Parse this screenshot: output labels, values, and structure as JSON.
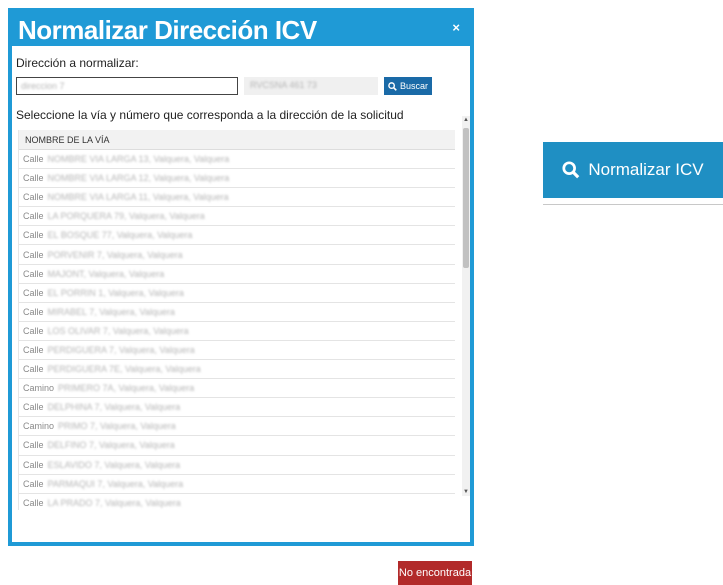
{
  "modal": {
    "title": "Normalizar Dirección ICV",
    "close_label": "×",
    "address_label": "Dirección a normalizar:",
    "address_value": "direccion 7",
    "code_value": "RVCSNA 461 73",
    "search_label": "Buscar",
    "instruction": "Seleccione la vía y número que corresponda a la dirección de la solicitud",
    "table": {
      "header": "NOMBRE DE LA VÍA",
      "rows": [
        {
          "type": "Calle",
          "detail": "NOMBRE VIA LARGA 13, Valquera, Valquera"
        },
        {
          "type": "Calle",
          "detail": "NOMBRE VIA LARGA 12, Valquera, Valquera"
        },
        {
          "type": "Calle",
          "detail": "NOMBRE VIA LARGA 11, Valquera, Valquera"
        },
        {
          "type": "Calle",
          "detail": "LA PORQUERA 79, Valquera, Valquera"
        },
        {
          "type": "Calle",
          "detail": "EL BOSQUE 77, Valquera, Valquera"
        },
        {
          "type": "Calle",
          "detail": "PORVENIR 7, Valquera, Valquera"
        },
        {
          "type": "Calle",
          "detail": "MAJONT, Valquera, Valquera"
        },
        {
          "type": "Calle",
          "detail": "EL PORRIN 1, Valquera, Valquera"
        },
        {
          "type": "Calle",
          "detail": "MIRABEL 7, Valquera, Valquera"
        },
        {
          "type": "Calle",
          "detail": "LOS OLIVAR 7, Valquera, Valquera"
        },
        {
          "type": "Calle",
          "detail": "PERDIGUERA 7, Valquera, Valquera"
        },
        {
          "type": "Calle",
          "detail": "PERDIGUERA 7E, Valquera, Valquera"
        },
        {
          "type": "Camino",
          "detail": "PRIMERO 7A, Valquera, Valquera"
        },
        {
          "type": "Calle",
          "detail": "DELPHINA 7, Valquera, Valquera"
        },
        {
          "type": "Camino",
          "detail": "PRIMO 7, Valquera, Valquera"
        },
        {
          "type": "Calle",
          "detail": "DELFINO 7, Valquera, Valquera"
        },
        {
          "type": "Calle",
          "detail": "ESLAVIDO 7, Valquera, Valquera"
        },
        {
          "type": "Calle",
          "detail": "PARMAQUI 7, Valquera, Valquera"
        },
        {
          "type": "Calle",
          "detail": "LA PRADO 7, Valquera, Valquera"
        }
      ]
    },
    "not_found_label": "No encontrada"
  },
  "normalize_button_label": "Normalizar ICV",
  "icons": {
    "search": "search-icon",
    "close": "close-icon",
    "scroll_up": "scroll-up-icon",
    "scroll_down": "scroll-down-icon"
  },
  "colors": {
    "modal_bg": "#1f9ad6",
    "search_button": "#1a6aa7",
    "not_found_button": "#b22a2a",
    "normalize_button": "#1f8fc3"
  }
}
